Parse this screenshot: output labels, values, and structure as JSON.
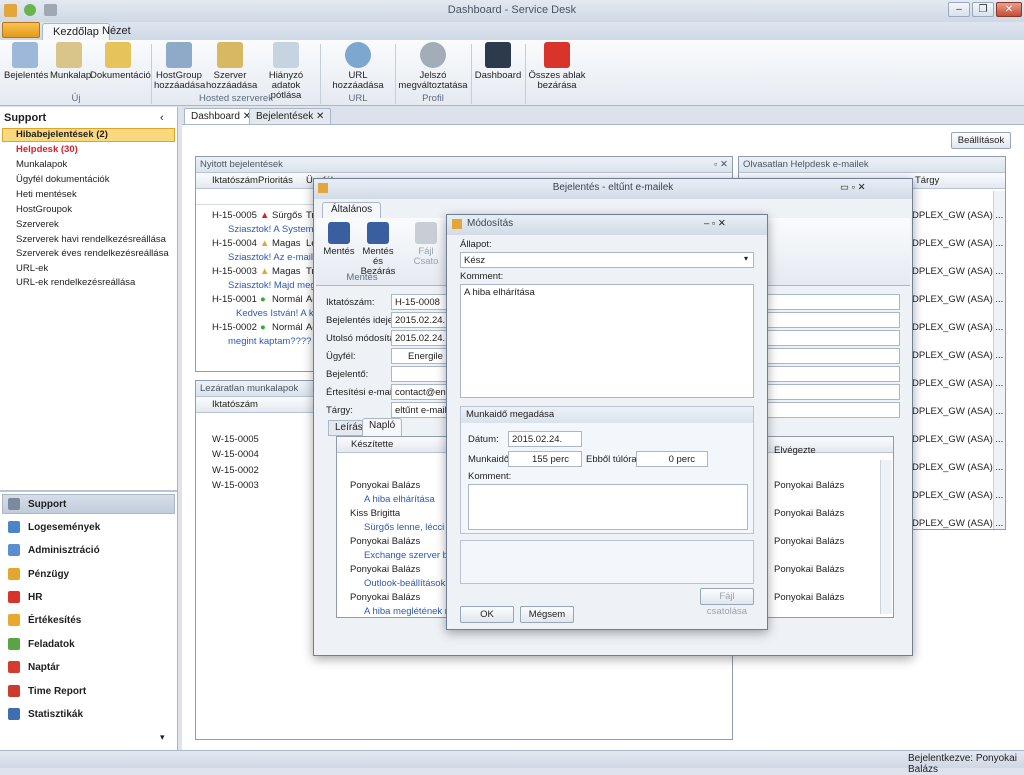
{
  "app": {
    "title": "Dashboard - Service Desk",
    "status": "Bejelentkezve: Ponyokai Balázs"
  },
  "ribbon_tabs": [
    "Kezdőlap",
    "Nézet"
  ],
  "ribbon": {
    "buttons": [
      {
        "label": "Bejelentés",
        "icon": "magnifier-doc-icon"
      },
      {
        "label": "Munkalap",
        "icon": "clipboard-icon"
      },
      {
        "label": "Dokumentáció",
        "icon": "folder-icon"
      },
      {
        "label": "HostGroup hozzáadása",
        "icon": "server-group-icon"
      },
      {
        "label": "Szerver hozzáadása",
        "icon": "server-add-icon"
      },
      {
        "label": "Hiányzó adatok pótlása",
        "icon": "checklist-icon"
      },
      {
        "label": "URL hozzáadása",
        "icon": "eye-icon"
      },
      {
        "label": "Jelszó megváltoztatása",
        "icon": "gear-icon"
      },
      {
        "label": "Dashboard",
        "icon": "monitor-icon"
      },
      {
        "label": "Összes ablak bezárása",
        "icon": "close-all-icon"
      }
    ],
    "groups": [
      "Új",
      "Hosted szerverek",
      "URL",
      "Profil"
    ]
  },
  "sidebar": {
    "title": "Support",
    "items": [
      "Hibabejelentések (2)",
      "Helpdesk (30)",
      "Munkalapok",
      "Ügyfél dokumentációk",
      "Heti mentések",
      "HostGroupok",
      "Szerverek",
      "Szerverek havi rendelkezésreállása",
      "Szerverek éves rendelkezésreállása",
      "URL-ek",
      "URL-ek rendelkezésreállása"
    ],
    "modules": [
      "Support",
      "Logesemények",
      "Adminisztráció",
      "Pénzügy",
      "HR",
      "Értékesítés",
      "Feladatok",
      "Naptár",
      "Time Report",
      "Statisztikák"
    ]
  },
  "doc_tabs": [
    "Dashboard",
    "Bejelentések"
  ],
  "settings_btn": "Beállítások",
  "open_tickets": {
    "title": "Nyitott bejelentések",
    "cols": [
      "Iktatószám",
      "Prioritás",
      "Ügyfél"
    ],
    "rows": [
      {
        "id": "H-15-0005",
        "prio": "Sürgős",
        "client": "Tr",
        "note": "Sziasztok!  A System és"
      },
      {
        "id": "H-15-0004",
        "prio": "Magas",
        "client": "Le",
        "note": "Sziasztok!  Az e-mail má"
      },
      {
        "id": "H-15-0003",
        "prio": "Magas",
        "client": "Tr",
        "note": "Sziasztok!  Majd meg tu"
      },
      {
        "id": "H-15-0001",
        "prio": "Normál",
        "client": "Ac",
        "note": "Kedves István!   A ki"
      },
      {
        "id": "H-15-0002",
        "prio": "Normál",
        "client": "Ac",
        "note": "megint kaptam???? ez ho"
      }
    ]
  },
  "worksheets": {
    "title": "Lezáratlan munkalapok",
    "col": "Iktatószám",
    "rows": [
      "W-15-0005",
      "W-15-0004",
      "W-15-0002",
      "W-15-0003"
    ]
  },
  "helpdesk": {
    "title": "Olvasatlan Helpdesk e-mailek",
    "col": "Tárgy",
    "rows": [
      "DPLEX_GW (ASA) ...",
      "DPLEX_GW (ASA) ...",
      "DPLEX_GW (ASA) ...",
      "DPLEX_GW (ASA) ...",
      "DPLEX_GW (ASA) ...",
      "DPLEX_GW (ASA) ...",
      "DPLEX_GW (ASA) ...",
      "DPLEX_GW (ASA) ...",
      "DPLEX_GW (ASA) ...",
      "DPLEX_GW (ASA) ...",
      "DPLEX_GW (ASA) ...",
      "DPLEX_GW (ASA) ..."
    ]
  },
  "ticket": {
    "title": "Bejelentés - eltűnt e-mailek",
    "tab": "Általános",
    "buttons": [
      "Mentés",
      "Mentés és Bezárás",
      "Fájl Csato"
    ],
    "group": "Mentés",
    "labels": [
      "Iktatószám:",
      "Bejelentés ideje:",
      "Utolsó módosítás:",
      "Ügyfél:",
      "Bejelentő:",
      "Értesítési e-mail:",
      "Tárgy:"
    ],
    "values": [
      "H-15-0008",
      "2015.02.24.",
      "2015.02.24.",
      "Energile Kft",
      "",
      "contact@ener",
      "eltűnt e-mailek"
    ],
    "subtabs": [
      "Leírás",
      "Napló"
    ],
    "log_cols": [
      "Készítette",
      "Elvégezte"
    ],
    "log": [
      {
        "who": "Ponyokai Balázs",
        "text": "A hiba elhárítása",
        "done": "Ponyokai Balázs"
      },
      {
        "who": "Kiss Brigitta",
        "text": "Sürgős lenne, lécci csin",
        "done": "Ponyokai Balázs"
      },
      {
        "who": "Ponyokai Balázs",
        "text": "Exchange szerver beáll",
        "done": "Ponyokai Balázs"
      },
      {
        "who": "Ponyokai Balázs",
        "text": "Outlook-beállítások elle",
        "done": "Ponyokai Balázs"
      },
      {
        "who": "Ponyokai Balázs",
        "text": "A hiba meglétének nyug",
        "done": "Ponyokai Balázs"
      }
    ]
  },
  "modify": {
    "title": "Módosítás",
    "state_label": "Állapot:",
    "state": "Kész",
    "comment_label": "Komment:",
    "comment": "A hiba elhárítása",
    "work_group": "Munkaidő megadása",
    "date_label": "Dátum:",
    "date": "2015.02.24.",
    "time_label": "Munkaidő:",
    "time": "155 perc",
    "over_label": "Ebből túlóra:",
    "over": "0 perc",
    "comment2_label": "Komment:",
    "attach": "Fájl csatolása",
    "ok": "OK",
    "cancel": "Mégsem"
  }
}
